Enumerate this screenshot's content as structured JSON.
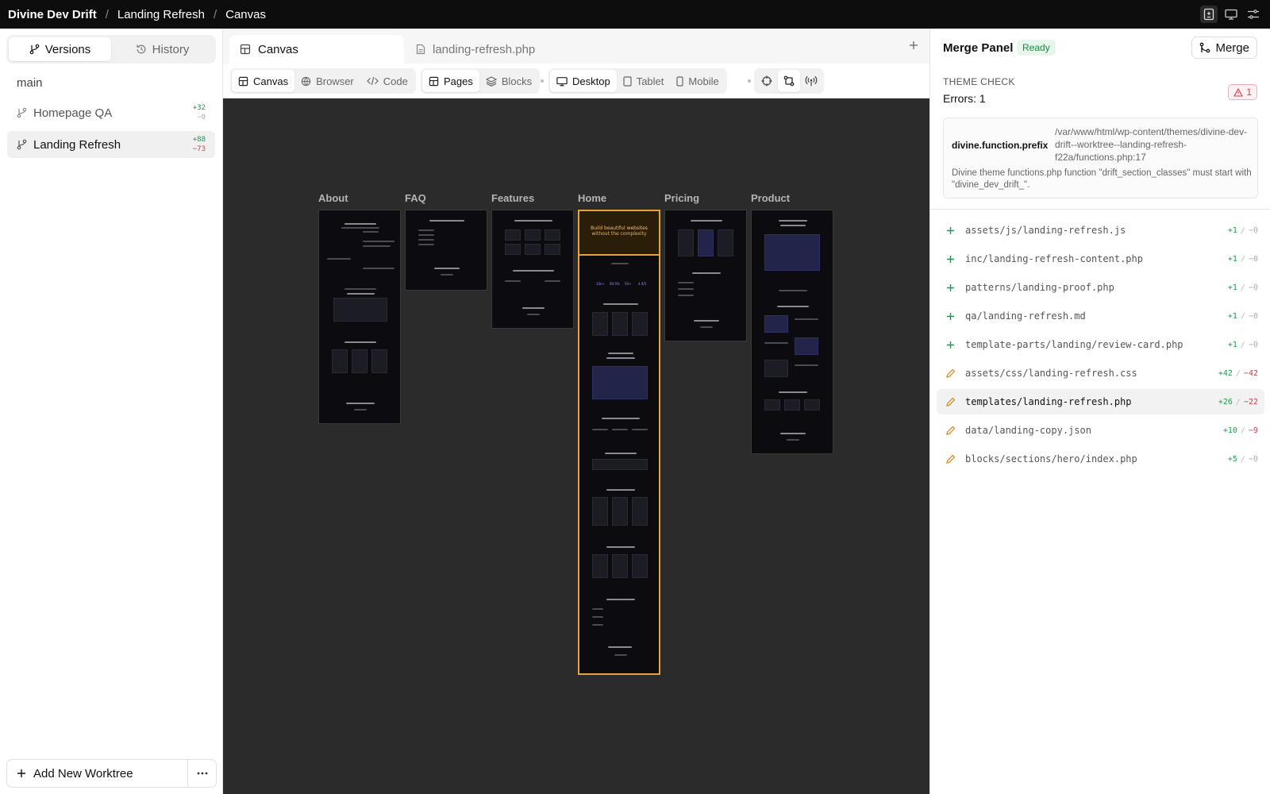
{
  "breadcrumb": {
    "project": "Divine Dev Drift",
    "worktree": "Landing Refresh",
    "view": "Canvas"
  },
  "sidebar": {
    "tabs": [
      {
        "label": "Versions"
      },
      {
        "label": "History"
      }
    ],
    "main_branch": "main",
    "worktrees": [
      {
        "name": "Homepage QA",
        "add": "+32",
        "del": "−0"
      },
      {
        "name": "Landing Refresh",
        "add": "+88",
        "del": "−73"
      }
    ],
    "add_worktree": "Add New Worktree"
  },
  "tabs": [
    {
      "label": "Canvas",
      "icon": "layout-icon"
    },
    {
      "label": "landing-refresh.php",
      "icon": "file-icon"
    }
  ],
  "toolbar": {
    "view_modes": [
      "Canvas",
      "Browser",
      "Code"
    ],
    "content_modes": [
      "Pages",
      "Blocks"
    ],
    "devices": [
      "Desktop",
      "Tablet",
      "Mobile"
    ]
  },
  "canvas": {
    "pages": [
      {
        "label": "About"
      },
      {
        "label": "FAQ"
      },
      {
        "label": "Features"
      },
      {
        "label": "Home"
      },
      {
        "label": "Pricing"
      },
      {
        "label": "Product"
      }
    ],
    "home_hero_line1": "Build beautiful websites",
    "home_hero_line2": "without the complexity",
    "home_stats": [
      "10k+",
      "99.9%",
      "50+",
      "4.9/5"
    ]
  },
  "merge_panel": {
    "title": "Merge Panel",
    "status": "Ready",
    "merge_label": "Merge",
    "theme_check_label": "THEME CHECK",
    "errors_text": "Errors: 1",
    "error_count": "1",
    "issue": {
      "rule": "divine.function.prefix",
      "path": "/var/www/html/wp-content/themes/divine-dev-drift--worktree--landing-refresh-f22a/functions.php:17",
      "message": "Divine theme functions.php function \"drift_section_classes\" must start with \"divine_dev_drift_\"."
    },
    "files": [
      {
        "status": "added",
        "name": "assets/js/landing-refresh.js",
        "add": "+1",
        "del": "−0"
      },
      {
        "status": "added",
        "name": "inc/landing-refresh-content.php",
        "add": "+1",
        "del": "−0"
      },
      {
        "status": "added",
        "name": "patterns/landing-proof.php",
        "add": "+1",
        "del": "−0"
      },
      {
        "status": "added",
        "name": "qa/landing-refresh.md",
        "add": "+1",
        "del": "−0"
      },
      {
        "status": "added",
        "name": "template-parts/landing/review-card.php",
        "add": "+1",
        "del": "−0"
      },
      {
        "status": "modified",
        "name": "assets/css/landing-refresh.css",
        "add": "+42",
        "del": "−42"
      },
      {
        "status": "modified",
        "name": "templates/landing-refresh.php",
        "add": "+26",
        "del": "−22"
      },
      {
        "status": "modified",
        "name": "data/landing-copy.json",
        "add": "+10",
        "del": "−9"
      },
      {
        "status": "modified",
        "name": "blocks/sections/hero/index.php",
        "add": "+5",
        "del": "−0"
      }
    ]
  },
  "colors": {
    "accent_orange": "#e8a23a",
    "add_green": "#1a9a4a",
    "del_red": "#d13b50",
    "canvas_bg": "#2b2b2b"
  }
}
